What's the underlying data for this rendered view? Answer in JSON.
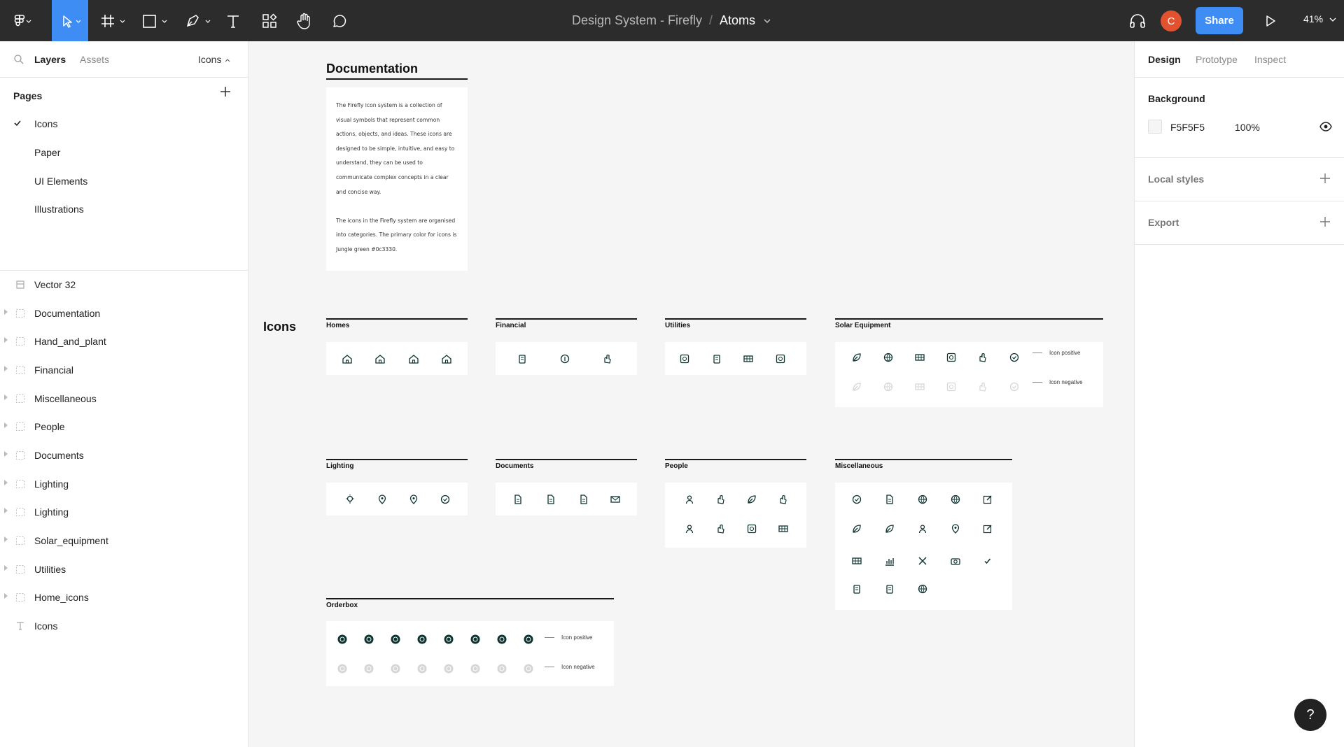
{
  "topbar": {
    "project": "Design System - Firefly",
    "separator": "/",
    "page": "Atoms",
    "avatar_initial": "C",
    "share_label": "Share",
    "zoom": "41%"
  },
  "left_panel": {
    "tabs": [
      "Layers",
      "Assets"
    ],
    "current_page_selector": "Icons",
    "pages_heading": "Pages",
    "pages": [
      {
        "label": "Icons",
        "selected": true
      },
      {
        "label": "Paper",
        "selected": false
      },
      {
        "label": "UI Elements",
        "selected": false
      },
      {
        "label": "Illustrations",
        "selected": false
      }
    ],
    "layers": [
      {
        "name": "Vector 32",
        "kind": "vector",
        "expandable": false
      },
      {
        "name": "Documentation",
        "kind": "frame",
        "expandable": true
      },
      {
        "name": "Hand_and_plant",
        "kind": "frame",
        "expandable": true
      },
      {
        "name": "Financial",
        "kind": "frame",
        "expandable": true
      },
      {
        "name": "Miscellaneous",
        "kind": "frame",
        "expandable": true
      },
      {
        "name": "People",
        "kind": "frame",
        "expandable": true
      },
      {
        "name": "Documents",
        "kind": "frame",
        "expandable": true
      },
      {
        "name": "Lighting",
        "kind": "frame",
        "expandable": true
      },
      {
        "name": "Lighting",
        "kind": "frame",
        "expandable": true
      },
      {
        "name": "Solar_equipment",
        "kind": "frame",
        "expandable": true
      },
      {
        "name": "Utilities",
        "kind": "frame",
        "expandable": true
      },
      {
        "name": "Home_icons",
        "kind": "frame",
        "expandable": true
      },
      {
        "name": "Icons",
        "kind": "text",
        "expandable": false
      }
    ]
  },
  "right_panel": {
    "tabs": [
      "Design",
      "Prototype",
      "Inspect"
    ],
    "background_heading": "Background",
    "background_hex": "F5F5F5",
    "background_opacity": "100%",
    "local_styles_heading": "Local styles",
    "export_heading": "Export"
  },
  "canvas": {
    "documentation_title": "Documentation",
    "documentation_paragraphs": [
      "The Firefly icon system is a collection of visual symbols that represent common actions, objects, and ideas. These icons are designed to be simple, intuitive, and easy to understand, they can be used to communicate complex concepts in a clear and concise way.",
      "The icons in the Firefly system are organised into categories. The primary color for icons is Jungle green #0c3330."
    ],
    "icons_heading": "Icons",
    "categories": {
      "homes": "Homes",
      "financial": "Financial",
      "utilities": "Utilities",
      "solar": "Solar Equipment",
      "lighting": "Lighting",
      "documents": "Documents",
      "people": "People",
      "misc": "Miscellaneous",
      "orderbox": "Orderbox"
    },
    "legend_positive": "Icon positive",
    "legend_negative": "Icon negative"
  },
  "colors": {
    "accent": "#3d8df5",
    "toolbar_bg": "#2c2c2c",
    "avatar": "#e2522f",
    "icon_primary": "#0c3330",
    "icon_negative": "#d6d6d6"
  },
  "help_label": "?"
}
